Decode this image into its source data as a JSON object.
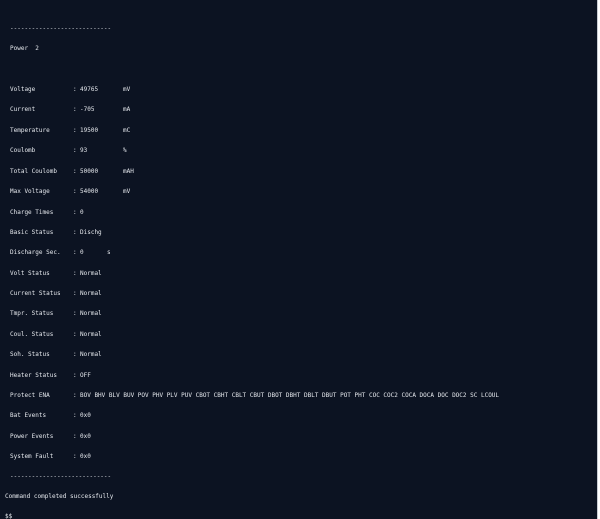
{
  "separator": "----------------------------",
  "power_label": "Power  2",
  "fields": [
    {
      "label": "Voltage",
      "value": "49765",
      "unit": "mV"
    },
    {
      "label": "Current",
      "value": "-705",
      "unit": "mA"
    },
    {
      "label": "Temperature",
      "value": "19500",
      "unit": "mC"
    },
    {
      "label": "Coulomb",
      "value": "93",
      "unit": "%"
    },
    {
      "label": "Total Coulomb",
      "value": "50000",
      "unit": "mAH"
    },
    {
      "label": "Max Voltage",
      "value": "54000",
      "unit": "mV"
    },
    {
      "label": "Charge Times",
      "value": "0",
      "unit": ""
    },
    {
      "label": "Basic Status",
      "value": "Dischg",
      "unit": ""
    },
    {
      "label": "Discharge Sec.",
      "value": "0",
      "unit": "s"
    },
    {
      "label": "Volt Status",
      "value": "Normal",
      "unit": ""
    },
    {
      "label": "Current Status",
      "value": "Normal",
      "unit": ""
    },
    {
      "label": "Tmpr. Status",
      "value": "Normal",
      "unit": ""
    },
    {
      "label": "Coul. Status",
      "value": "Normal",
      "unit": ""
    },
    {
      "label": "Soh. Status",
      "value": "Normal",
      "unit": ""
    },
    {
      "label": "Heater Status",
      "value": "OFF",
      "unit": ""
    },
    {
      "label": "Protect ENA",
      "value": "BOV BHV BLV BUV POV PHV PLV PUV CBOT CBHT CBLT CBUT DBOT DBHT DBLT DBUT POT PHT COC COC2 COCA DOCA DOC DOC2 SC LCOUL",
      "unit": ""
    },
    {
      "label": "Bat Events",
      "value": "0x0",
      "unit": ""
    },
    {
      "label": "Power Events",
      "value": "0x0",
      "unit": ""
    },
    {
      "label": "System Fault",
      "value": "0x0",
      "unit": ""
    }
  ],
  "colon": ":",
  "status_message": "Command completed successfully",
  "prompt": "$$"
}
